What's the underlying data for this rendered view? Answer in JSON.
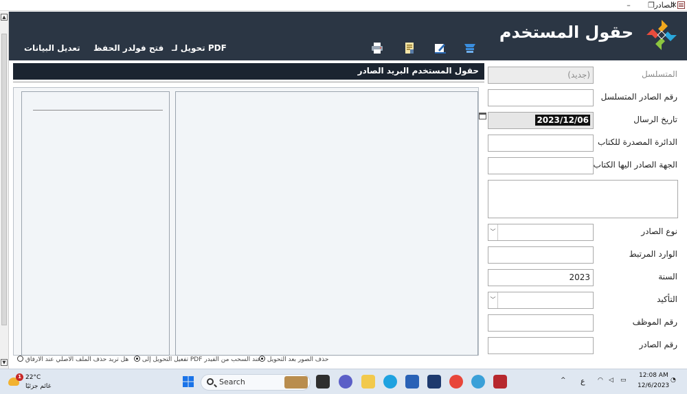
{
  "window": {
    "title": "الصادر",
    "min": "–",
    "restore": "❐",
    "close": "✕"
  },
  "header": {
    "app_title": "حقول المستخدم",
    "menu": {
      "edit_data": "تعديل البيانات",
      "open_save_folders": "فتح فولدر الحفظ",
      "convert_pdf": "تحويل لـ PDF"
    },
    "icons": [
      "printer-icon",
      "document-icon",
      "edit-icon",
      "scanner-icon"
    ]
  },
  "section_title": "حقول المستخدم البريد الصادر",
  "form": {
    "serial": {
      "label": "المتسلسل",
      "value": "(جديد)"
    },
    "outgoing_serial_no": {
      "label": "رقم الصادر المتسلسل",
      "value": ""
    },
    "send_date": {
      "label": "تاريخ الرسال",
      "value": "2023/12/06"
    },
    "issuing_department": {
      "label": "الدائرة المصدرة للكتاب",
      "value": ""
    },
    "recipient": {
      "label": "الجهة الصادر اليها الكتاب",
      "value": ""
    },
    "outgoing_type": {
      "label": "نوع الصادر",
      "value": ""
    },
    "linked_incoming": {
      "label": "الوارد المرتبط",
      "value": ""
    },
    "year": {
      "label": "السنة",
      "value": "2023"
    },
    "confirmation": {
      "label": "التأكيد",
      "value": ""
    },
    "employee_no": {
      "label": "رقم الموظف",
      "value": ""
    },
    "outgoing_no": {
      "label": "رقم الصادر",
      "value": ""
    }
  },
  "options": {
    "delete_images": "حذف الصور بعد التحويل",
    "enable_pdf_drag": "تفعيل التحويل إلى PDF عند السحب من الفيدر",
    "delete_original": "هل تريد حذف الملف الاصلي عند الارفاق"
  },
  "taskbar": {
    "search_placeholder": "Search",
    "weather_temp": "22°C",
    "weather_condition": "غائم جزئيًا",
    "weather_badge": "1",
    "lang": "ع",
    "time": "12:08 AM",
    "date": "12/6/2023",
    "chevron": "^"
  },
  "colors": {
    "header_bg": "#2b3644",
    "section_bg": "#1b2430",
    "taskbar_bg": "#dfe7f1"
  }
}
